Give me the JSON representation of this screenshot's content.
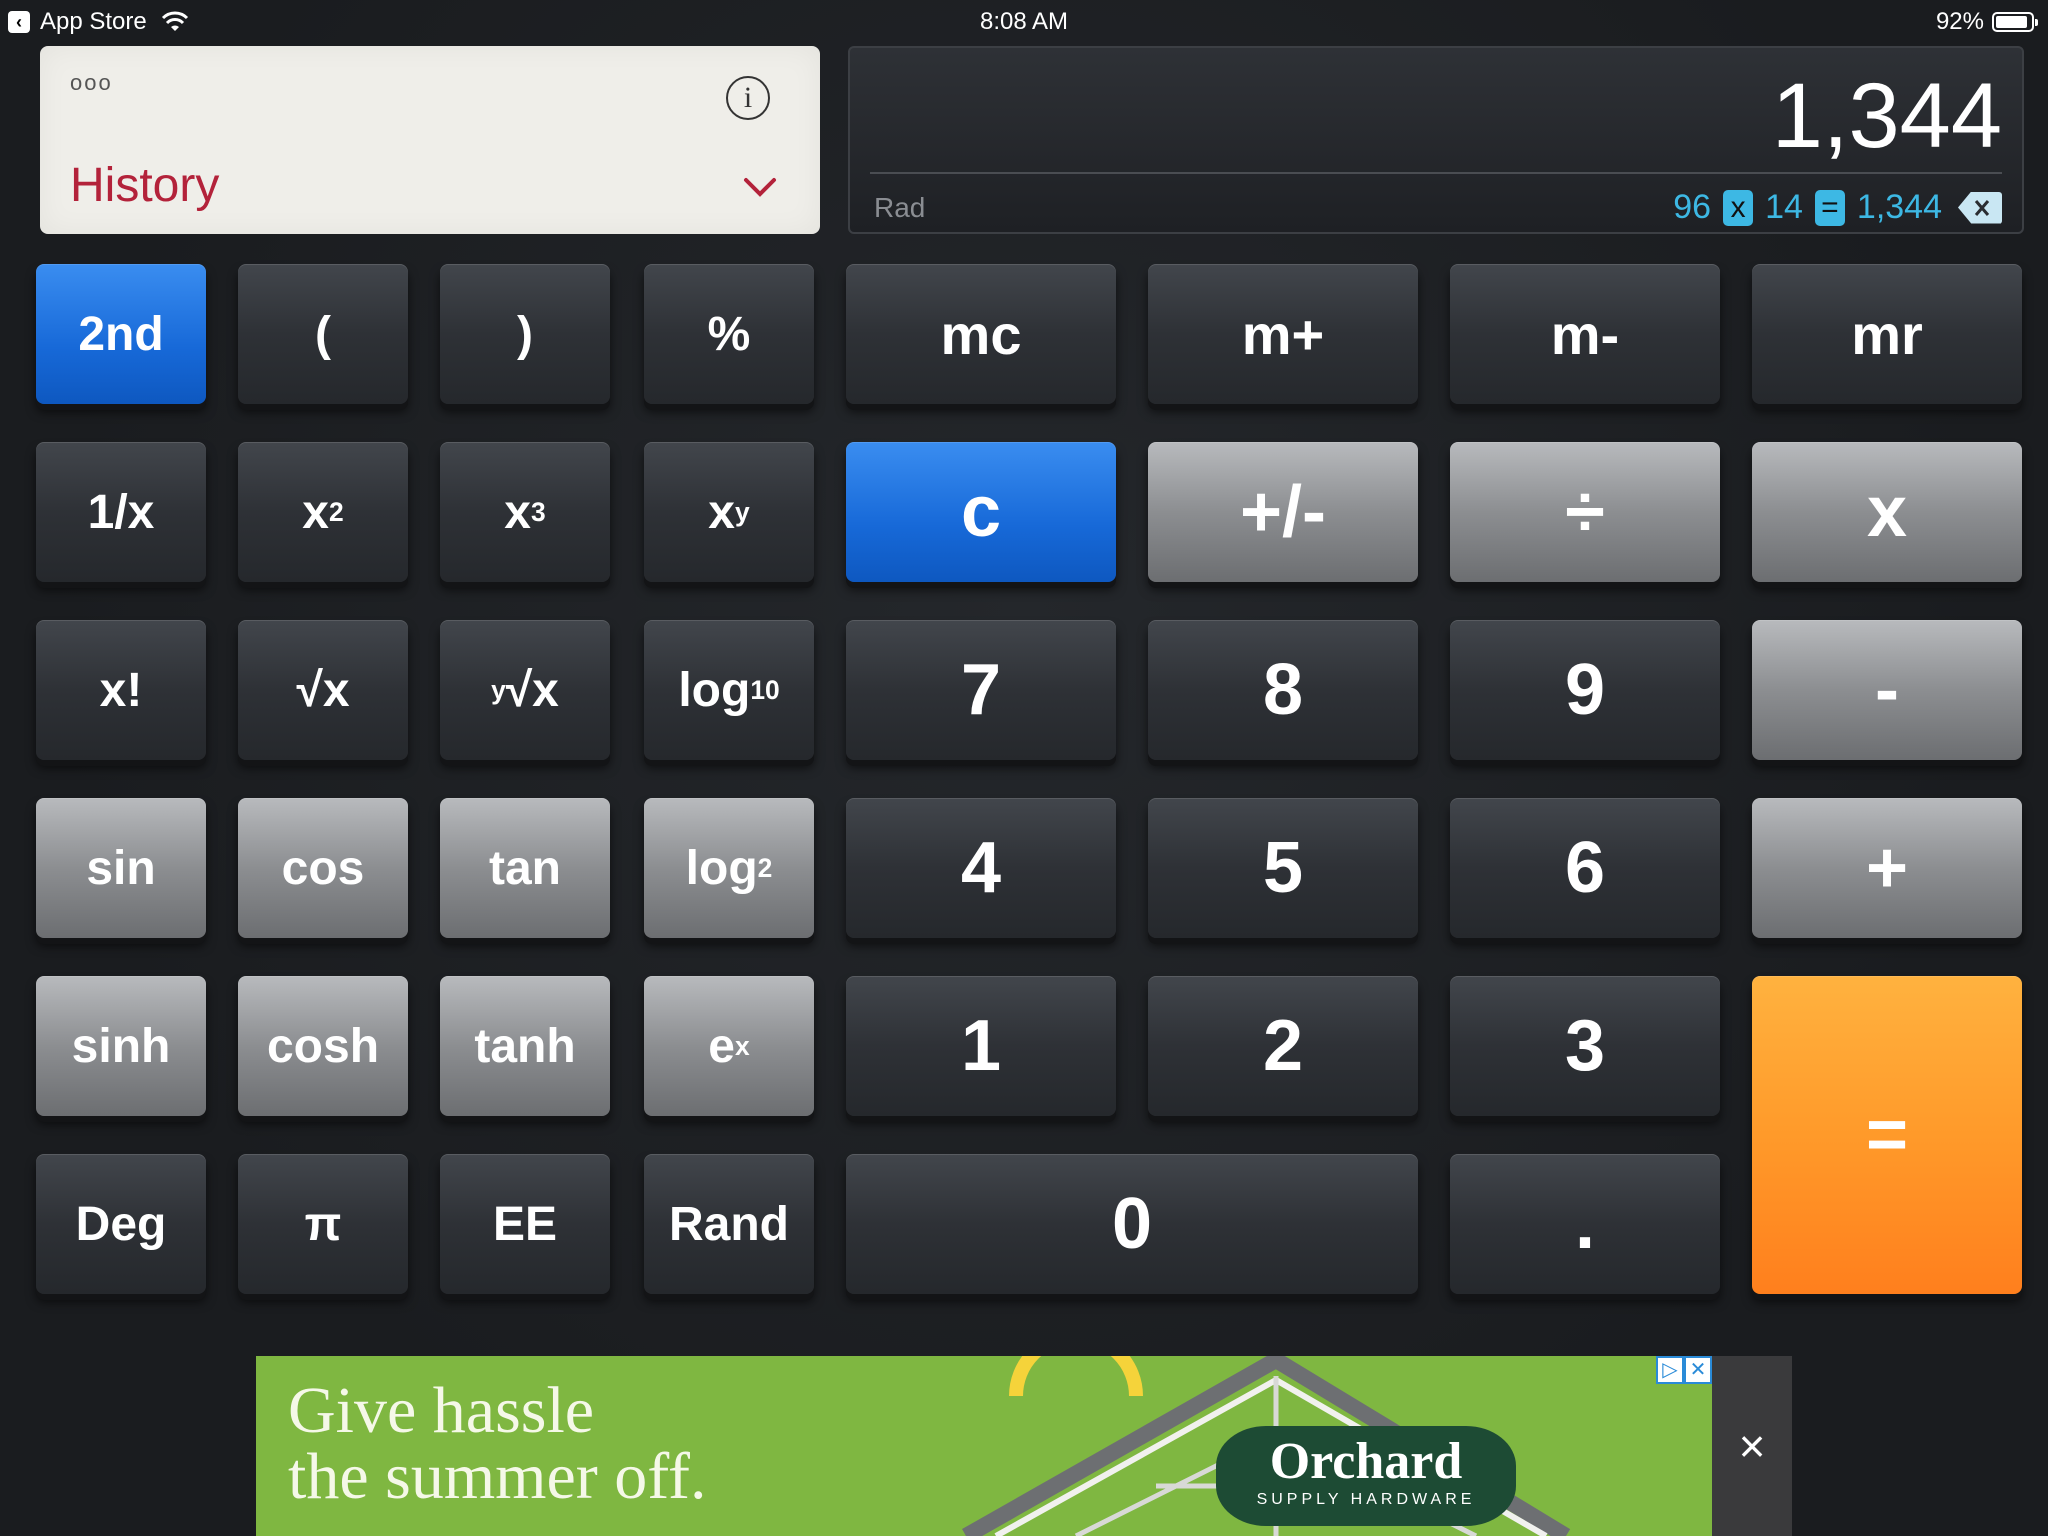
{
  "status_bar": {
    "back_app": "App Store",
    "time": "8:08 AM",
    "battery": "92%",
    "battery_level": 0.92
  },
  "history": {
    "dots": "ooo",
    "title": "History",
    "info_glyph": "i"
  },
  "display": {
    "value": "1,344",
    "mode": "Rad",
    "expression": {
      "operand1": "96",
      "operator": "x",
      "operand2": "14",
      "equals": "=",
      "result": "1,344"
    }
  },
  "keys": {
    "second": "2nd",
    "lparen": "(",
    "rparen": ")",
    "percent": "%",
    "mc": "mc",
    "mplus": "m+",
    "mminus": "m-",
    "mr": "mr",
    "recip": "1/x",
    "x2_base": "x",
    "x2_exp": "2",
    "x3_base": "x",
    "x3_exp": "3",
    "xy_base": "x",
    "xy_exp": "y",
    "clear": "c",
    "sign": "+/-",
    "divide": "÷",
    "multiply": "x",
    "fact": "x!",
    "sqrt": "√x",
    "yroot_y": "y",
    "yroot_rest": "√x",
    "log10_base": "log",
    "log10_sub": "10",
    "seven": "7",
    "eight": "8",
    "nine": "9",
    "minus": "-",
    "sin": "sin",
    "cos": "cos",
    "tan": "tan",
    "log2_base": "log",
    "log2_sub": "2",
    "four": "4",
    "five": "5",
    "six": "6",
    "plus": "+",
    "sinh": "sinh",
    "cosh": "cosh",
    "tanh": "tanh",
    "ex_base": "e",
    "ex_exp": "x",
    "one": "1",
    "two": "2",
    "three": "3",
    "equals": "=",
    "deg": "Deg",
    "pi": "π",
    "ee": "EE",
    "rand": "Rand",
    "zero": "0",
    "decimal": "."
  },
  "ad": {
    "line1": "Give hassle",
    "line2": "the summer off.",
    "brand": "Orchard",
    "brand_sub": "SUPPLY HARDWARE",
    "close": "×"
  },
  "colors": {
    "accent_blue": "#1769d8",
    "orange": "#ff9a2a",
    "history_red": "#b3223a",
    "expr_cyan": "#3db8e4"
  }
}
